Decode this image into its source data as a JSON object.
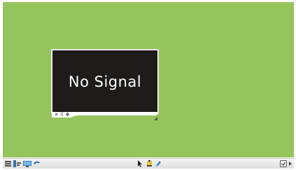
{
  "screen": {
    "desktop_color": "#95c45c",
    "frame_color": "#ffffff"
  },
  "preview_window": {
    "status_text": "No Signal",
    "background_color": "#1e1b1a",
    "text_color": "#ffffff",
    "controls": [
      {
        "icon": "close-icon",
        "glyph": "✕"
      },
      {
        "icon": "grid-icon",
        "glyph": "⠿"
      },
      {
        "icon": "move-icon",
        "glyph": "✥"
      }
    ]
  },
  "taskbar": {
    "left_icons": [
      "menu-icon",
      "input-source-icon",
      "monitor-icon",
      "back-icon"
    ],
    "center_icons": [
      "pointer-icon",
      "pen-icon",
      "eraser-icon"
    ],
    "right_icons": [
      "screen-toggle-icon",
      "next-icon"
    ]
  }
}
